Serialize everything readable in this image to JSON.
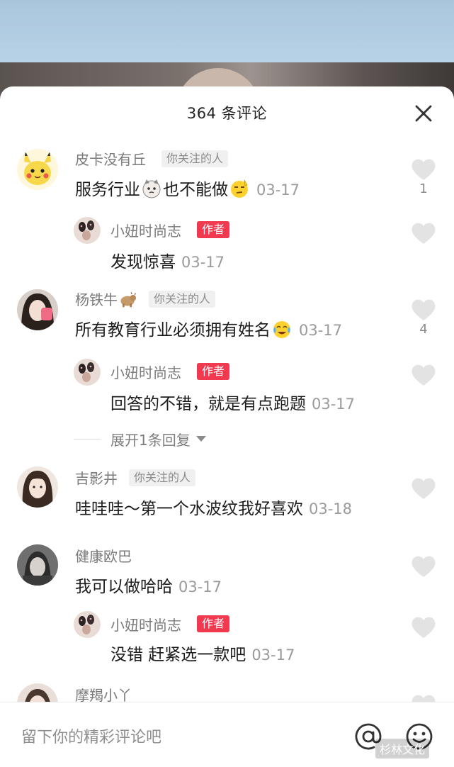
{
  "sheet": {
    "title": "364 条评论"
  },
  "comments": [
    {
      "user": "皮卡没有丘",
      "tag": "你关注的人",
      "text_a": "服务行业",
      "text_b": "也不能做",
      "date": "03-17",
      "likes": "1",
      "avatar_icon": "pikachu-avatar-icon",
      "emojis": [
        "cat-emoji-icon",
        "eyeroll-emoji-icon"
      ]
    },
    {
      "user": "小妞时尚志",
      "tag": "作者",
      "text": "发现惊喜",
      "date": "03-17"
    },
    {
      "user": "杨铁牛",
      "tag": "你关注的人",
      "text": "所有教育行业必须拥有姓名",
      "date": "03-17",
      "likes": "4",
      "emojis": [
        "cow-emoji-icon",
        "crying-laugh-emoji-icon"
      ]
    },
    {
      "user": "小妞时尚志",
      "tag": "作者",
      "text": "回答的不错，就是有点跑题",
      "date": "03-17"
    },
    {
      "user": "吉影井",
      "tag": "你关注的人",
      "text": "哇哇哇～第一个水波纹我好喜欢",
      "date": "03-18"
    },
    {
      "user": "健康欧巴",
      "text": "我可以做哈哈",
      "date": "03-17"
    },
    {
      "user": "小妞时尚志",
      "tag": "作者",
      "text": "没错 赶紧选一款吧",
      "date": "03-17"
    },
    {
      "user": "摩羯小丫"
    }
  ],
  "expand": {
    "label": "展开1条回复"
  },
  "input": {
    "placeholder": "留下你的精彩评论吧"
  },
  "watermark": "杉林文化",
  "colors": {
    "author_tag": "#f1394f",
    "tag_bg": "#f0f0f0",
    "secondary_text": "#7a7a7a",
    "like_icon": "#e3e3e3"
  }
}
